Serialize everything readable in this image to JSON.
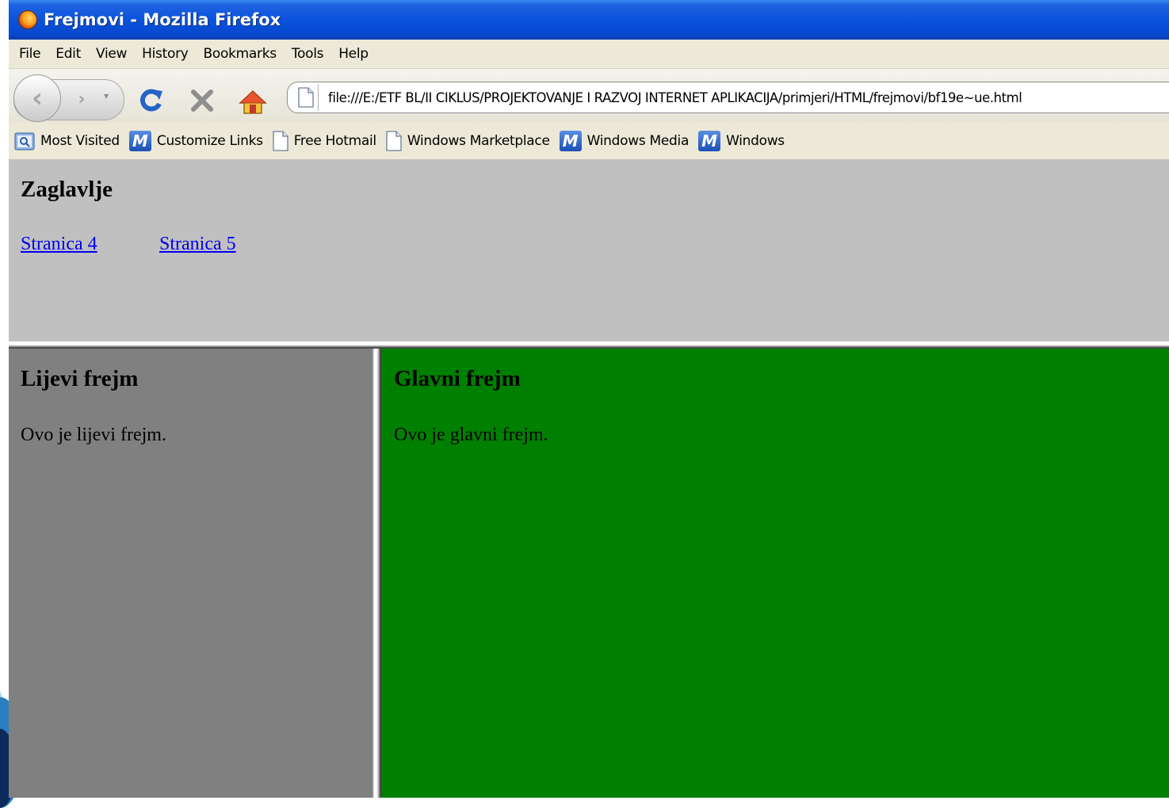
{
  "window": {
    "title": "Frejmovi - Mozilla Firefox"
  },
  "menu": {
    "items": [
      "File",
      "Edit",
      "View",
      "History",
      "Bookmarks",
      "Tools",
      "Help"
    ]
  },
  "navigation": {
    "url": "file:///E:/ETF BL/II CIKLUS/PROJEKTOVANJE I RAZVOJ INTERNET APLIKACIJA/primjeri/HTML/frejmovi/bf19e~ue.html"
  },
  "bookmarks": {
    "items": [
      {
        "label": "Most Visited",
        "icon": "most-visited-icon"
      },
      {
        "label": "Customize Links",
        "icon": "msn-icon"
      },
      {
        "label": "Free Hotmail",
        "icon": "page-icon"
      },
      {
        "label": "Windows Marketplace",
        "icon": "page-icon"
      },
      {
        "label": "Windows Media",
        "icon": "msn-icon"
      },
      {
        "label": "Windows",
        "icon": "msn-icon"
      }
    ]
  },
  "frames": {
    "top": {
      "heading": "Zaglavlje",
      "links": [
        "Stranica 4",
        "Stranica 5"
      ],
      "background": "#c0c0c0"
    },
    "left": {
      "heading": "Lijevi frejm",
      "text": "Ovo je lijevi frejm.",
      "background": "#808080"
    },
    "main": {
      "heading": "Glavni frejm",
      "text": "Ovo je glavni frejm.",
      "background": "#008000"
    }
  },
  "colors": {
    "titlebar": "#0a52dd",
    "link": "#0000ee"
  }
}
